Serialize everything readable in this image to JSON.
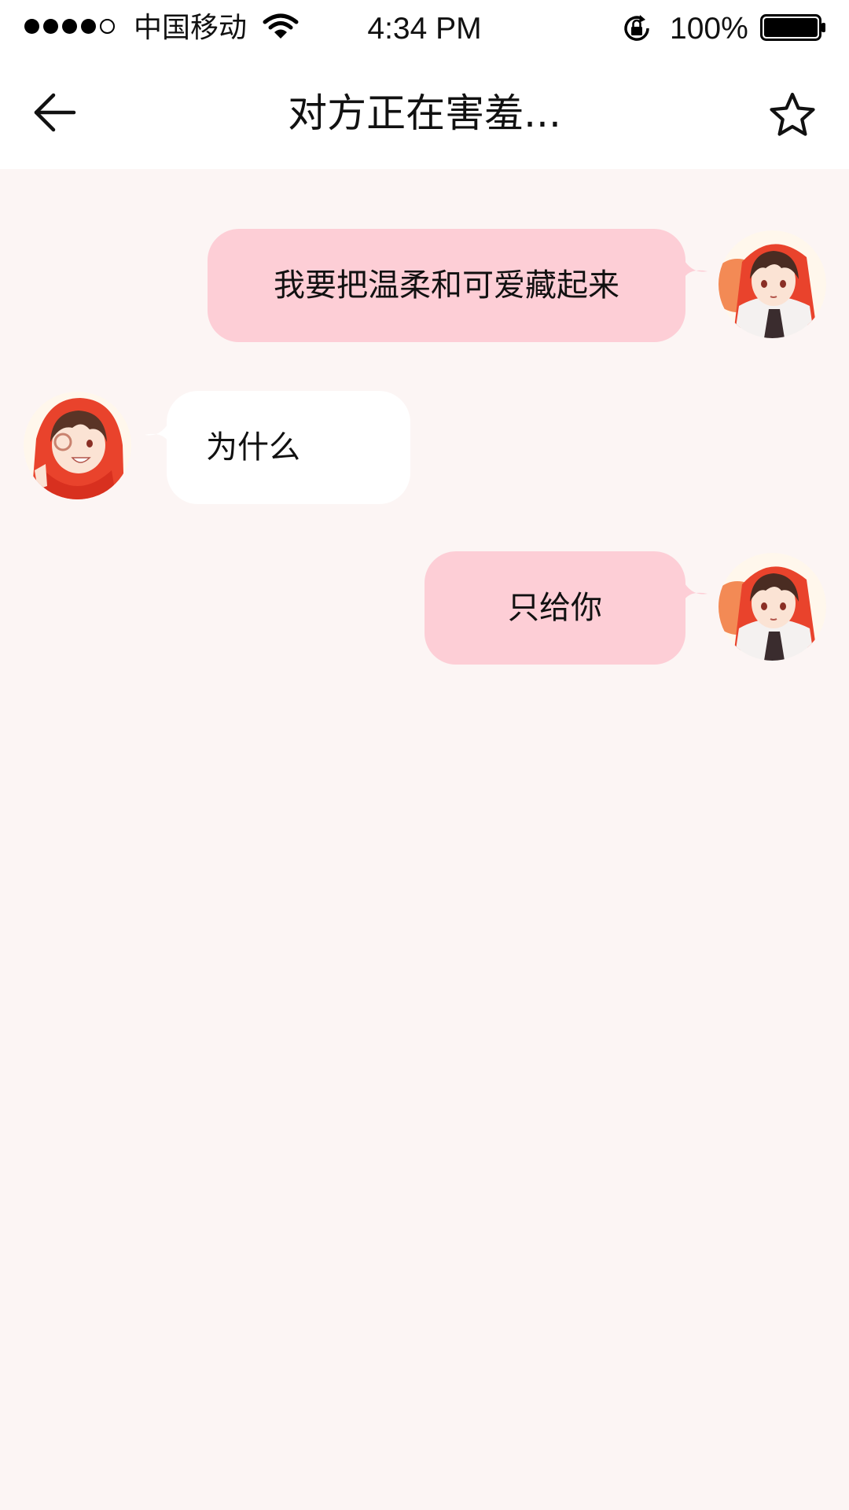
{
  "status_bar": {
    "carrier": "中国移动",
    "time": "4:34 PM",
    "battery": "100%",
    "signal_bars_filled": 4,
    "signal_bars_total": 5
  },
  "nav": {
    "title": "对方正在害羞...",
    "back_icon": "arrow-left-icon",
    "favorite_icon": "star-outline-icon"
  },
  "messages": [
    {
      "sender": "me",
      "text": "我要把温柔和可爱藏起来"
    },
    {
      "sender": "them",
      "text": "为什么"
    },
    {
      "sender": "me",
      "text": "只给你"
    }
  ],
  "colors": {
    "background": "#FCF5F4",
    "bubble_me": "#FDCED6",
    "bubble_them": "#FFFFFF",
    "accent_red": "#E9432C"
  }
}
